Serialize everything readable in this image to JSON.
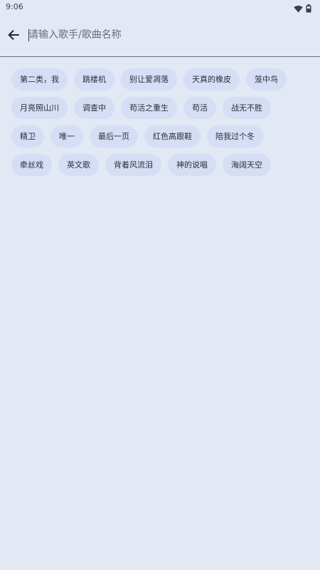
{
  "status_bar": {
    "time": "9:06",
    "icons": [
      "wifi-icon",
      "battery-icon"
    ]
  },
  "search": {
    "placeholder": "请输入歌手/歌曲名称",
    "value": "",
    "back_icon": "arrow-back-icon"
  },
  "tags": [
    [
      "第二类，我",
      "跳楼机",
      "别让爱凋落",
      "天真的橡皮",
      "笼中鸟"
    ],
    [
      "月亮照山川",
      "调查中",
      "苟活之重生",
      "苟活",
      "战无不胜"
    ],
    [
      "精卫",
      "唯一",
      "最后一页",
      "红色高跟鞋",
      "陪我过个冬"
    ],
    [
      "牵丝戏",
      "英文歌",
      "背着风流泪",
      "神的说唱",
      "海阔天空"
    ]
  ],
  "colors": {
    "background": "#e2e8f4",
    "chip": "#d6def5",
    "text": "#2a2f3a"
  }
}
